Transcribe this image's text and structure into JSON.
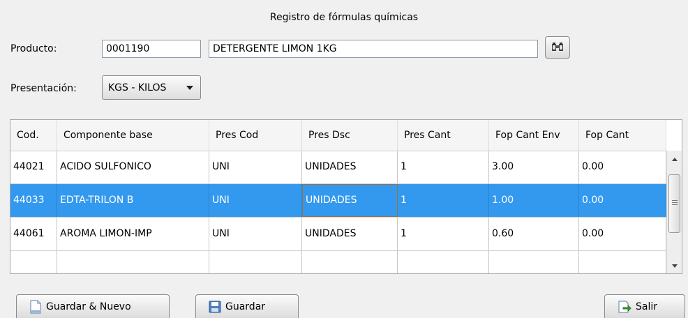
{
  "window": {
    "title": "Registro de fórmulas químicas"
  },
  "producto": {
    "label": "Producto:",
    "code": "0001190",
    "description": "DETERGENTE LIMON 1KG"
  },
  "presentacion": {
    "label": "Presentación:",
    "selected": "KGS - KILOS"
  },
  "grid": {
    "columns": [
      "Cod.",
      "Componente base",
      "Pres Cod",
      "Pres Dsc",
      "Pres Cant",
      "Fop Cant Env",
      "Fop Cant"
    ],
    "rows": [
      [
        "44021",
        "ACIDO SULFONICO",
        "UNI",
        "UNIDADES",
        "1",
        "3.00",
        "0.00"
      ],
      [
        "44033",
        "EDTA-TRILON B",
        "UNI",
        "UNIDADES",
        "1",
        "1.00",
        "0.00"
      ],
      [
        "44061",
        "AROMA LIMON-IMP",
        "UNI",
        "UNIDADES",
        "1",
        "0.60",
        "0.00"
      ],
      [
        "",
        "",
        "",
        "",
        "",
        "",
        ""
      ]
    ],
    "selected_row": 1
  },
  "buttons": {
    "guardar_nuevo": "Guardar & Nuevo",
    "guardar": "Guardar",
    "salir": "Salir"
  },
  "icons": {
    "lookup": "binoculars-icon",
    "new_doc": "document-icon",
    "save": "floppy-disk-icon",
    "exit": "exit-icon"
  }
}
